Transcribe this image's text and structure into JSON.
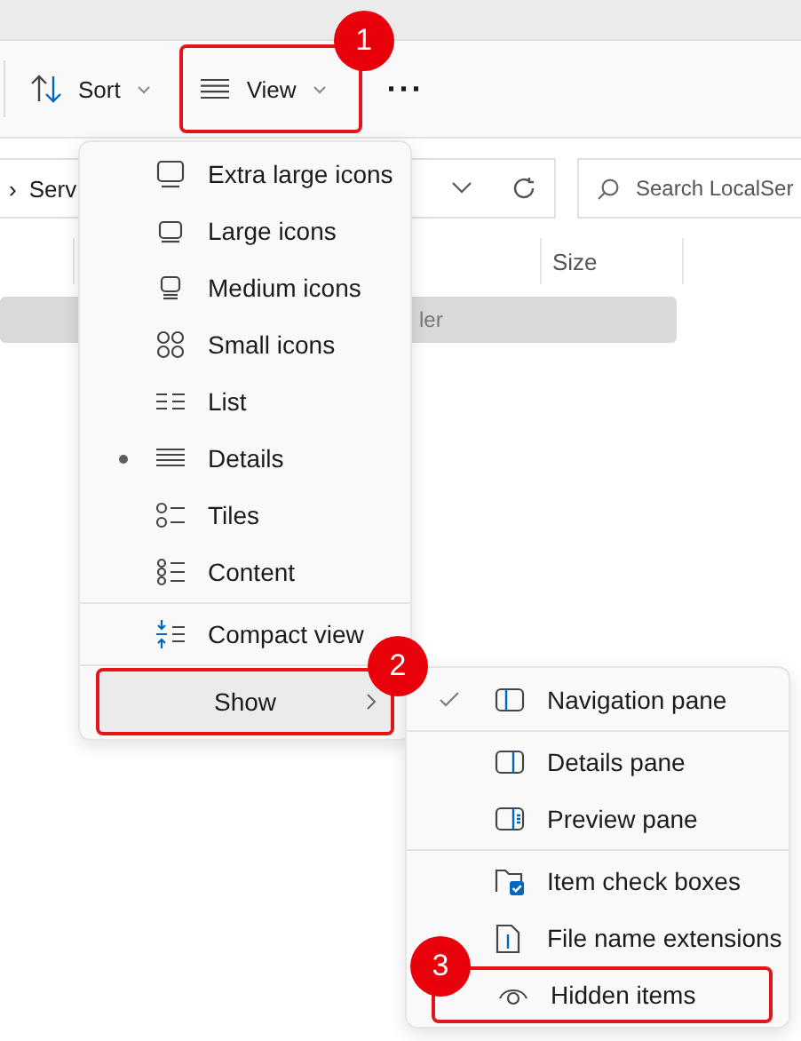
{
  "toolbar": {
    "buttons": [
      {
        "kind": "sort",
        "label": "Sort"
      },
      {
        "kind": "view",
        "label": "View",
        "callout": "1"
      },
      {
        "kind": "more",
        "label": "···"
      }
    ]
  },
  "address_bar": {
    "chevron": "›",
    "path": "Serv"
  },
  "search": {
    "placeholder": "Search LocalSer"
  },
  "columns": [
    {
      "label": "Size"
    }
  ],
  "selected_row": {
    "text": "ler"
  },
  "view_menu": {
    "groups": [
      [
        {
          "kind": "option",
          "label": "Extra large icons",
          "selected": false
        },
        {
          "kind": "option",
          "label": "Large icons",
          "selected": false
        },
        {
          "kind": "option",
          "label": "Medium icons",
          "selected": false
        },
        {
          "kind": "option",
          "label": "Small icons",
          "selected": false
        },
        {
          "kind": "option",
          "label": "List",
          "selected": false
        },
        {
          "kind": "option",
          "label": "Details",
          "selected": true
        },
        {
          "kind": "option",
          "label": "Tiles",
          "selected": false
        },
        {
          "kind": "option",
          "label": "Content",
          "selected": false
        }
      ],
      [
        {
          "kind": "toggle",
          "label": "Compact view",
          "checked": false
        }
      ],
      [
        {
          "kind": "submenu",
          "label": "Show",
          "highlighted": true,
          "callout": "2"
        }
      ]
    ]
  },
  "show_menu": {
    "groups": [
      [
        {
          "label": "Navigation pane",
          "checked": true
        }
      ],
      [
        {
          "label": "Details pane",
          "checked": false
        },
        {
          "label": "Preview pane",
          "checked": false
        }
      ],
      [
        {
          "label": "Item check boxes",
          "checked": false
        },
        {
          "label": "File name extensions",
          "checked": false
        },
        {
          "label": "Hidden items",
          "checked": false,
          "callout": "3"
        }
      ]
    ]
  }
}
